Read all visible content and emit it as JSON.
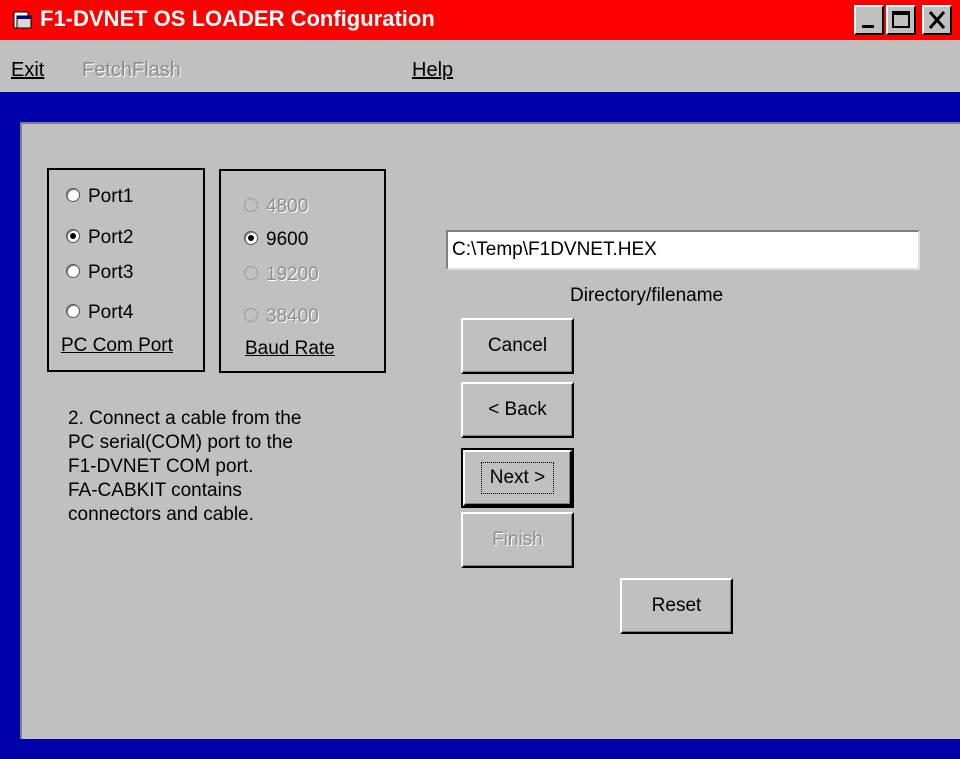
{
  "window": {
    "title": "F1-DVNET OS LOADER Configuration",
    "title_bar_color": "#ff0000",
    "frame_color": "#0000aa",
    "controls": [
      "minimize-icon",
      "maximize-icon",
      "close-icon"
    ]
  },
  "menu": {
    "exit": "Exit",
    "fetchflash": "FetchFlash",
    "help": "Help"
  },
  "com_port": {
    "caption": "PC Com Port",
    "options": [
      "Port1",
      "Port2",
      "Port3",
      "Port4"
    ],
    "selected": "Port2"
  },
  "baud_rate": {
    "caption": "Baud Rate",
    "options": [
      "4800",
      "9600",
      "19200",
      "38400"
    ],
    "selected": "9600",
    "disabled": [
      "4800",
      "19200",
      "38400"
    ]
  },
  "file": {
    "value": "C:\\Temp\\F1DVNET.HEX",
    "label": "Directory/filename"
  },
  "instructions": [
    "2. Connect a cable from the",
    "PC serial(COM) port to the",
    "F1-DVNET COM port.",
    "FA-CABKIT contains",
    "connectors and cable."
  ],
  "buttons": {
    "cancel": "Cancel",
    "back": "< Back",
    "next": "Next >",
    "finish": "Finish",
    "reset": "Reset"
  }
}
